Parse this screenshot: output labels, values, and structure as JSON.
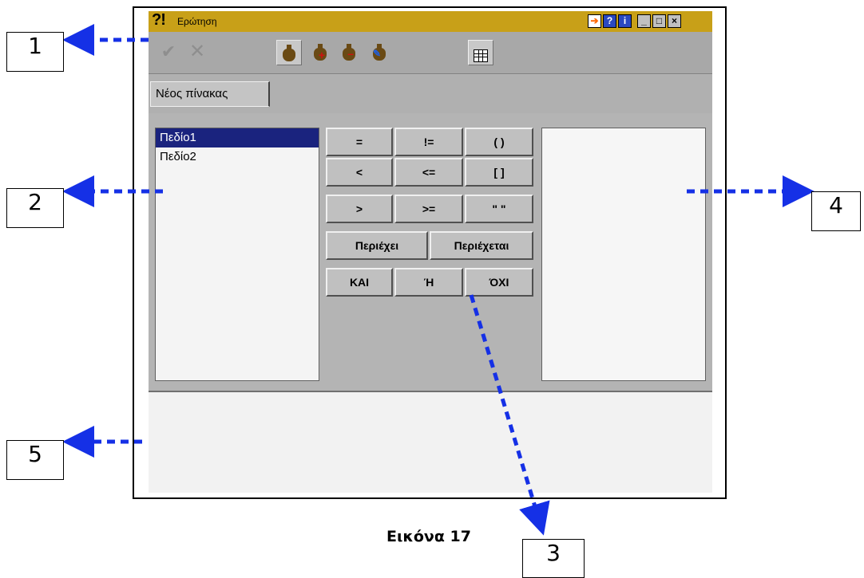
{
  "window": {
    "title_icon": "?!",
    "title": "Ερώτηση",
    "title_buttons": [
      "arrow-icon",
      "help-icon",
      "info-icon",
      "minimize-icon",
      "maximize-icon",
      "close-icon"
    ]
  },
  "toolbar": {
    "tools": [
      "check-icon",
      "x-icon",
      "bag-icon",
      "bag-plus-icon",
      "bag-minus-icon",
      "bag-search-icon",
      "grid-icon"
    ]
  },
  "tab": {
    "label": "Νέος πίνακας"
  },
  "fields": [
    "Πεδίο1",
    "Πεδίο2"
  ],
  "operators": {
    "eq": "=",
    "neq": "!=",
    "paren": "( )",
    "lt": "<",
    "lte": "<=",
    "brackets": "[ ]",
    "gt": ">",
    "gte": ">=",
    "quotes": "\" \"",
    "contains": "Περιέχει",
    "contained": "Περιέχεται",
    "and": "ΚΑΙ",
    "or": "Ή",
    "not": "ΌΧΙ"
  },
  "callouts": {
    "c1": "1",
    "c2": "2",
    "c3": "3",
    "c4": "4",
    "c5": "5"
  },
  "caption": "Εικόνα 17",
  "colors": {
    "titlebar": "#c8a018",
    "selection": "#1a237e",
    "arrow": "#1530e6"
  }
}
